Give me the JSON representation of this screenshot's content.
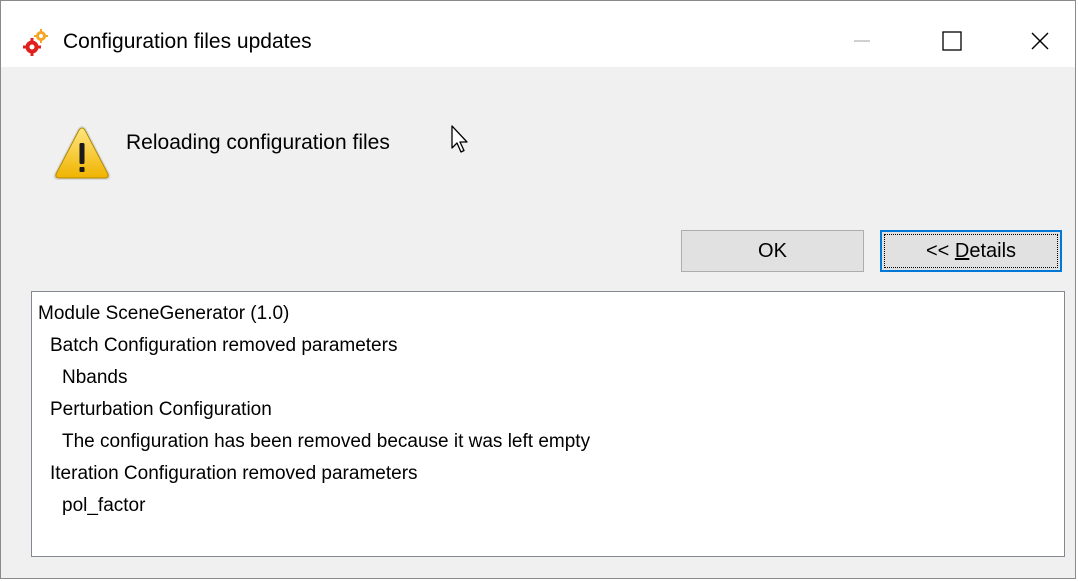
{
  "window": {
    "title": "Configuration files updates",
    "icon": "gears-icon",
    "controls": {
      "minimize": "minimize-icon",
      "maximize": "maximize-icon",
      "close": "close-icon"
    }
  },
  "dialog": {
    "icon": "warning-icon",
    "message": "Reloading configuration files",
    "buttons": {
      "ok_label": "OK",
      "details_label": "<< Details",
      "details_prefix": "<< ",
      "details_mnemonic": "D",
      "details_rest": "etails"
    }
  },
  "details": {
    "lines": [
      {
        "text": "Module SceneGenerator (1.0)",
        "level": 0
      },
      {
        "text": "Batch Configuration removed parameters",
        "level": 1
      },
      {
        "text": "Nbands",
        "level": 2
      },
      {
        "text": "Perturbation Configuration",
        "level": 1
      },
      {
        "text": "The configuration has been removed because it was left empty",
        "level": 2
      },
      {
        "text": "Iteration Configuration removed parameters",
        "level": 1
      },
      {
        "text": "pol_factor",
        "level": 2
      }
    ]
  },
  "colors": {
    "focus_border": "#0078d7",
    "warning_yellow": "#f5c518",
    "gear_red": "#e0201c",
    "gear_orange": "#f5a623"
  }
}
